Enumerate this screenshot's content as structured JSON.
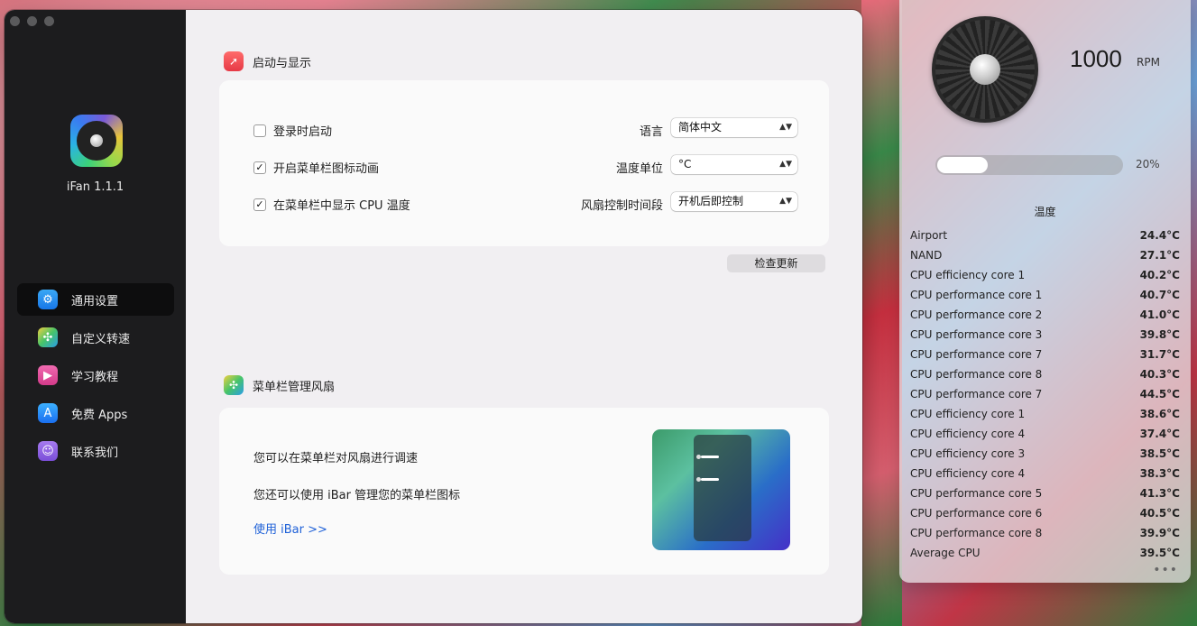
{
  "app": {
    "name": "iFan 1.1.1"
  },
  "sidebar": {
    "items": [
      {
        "label": "通用设置",
        "icon": "gear-icon"
      },
      {
        "label": "自定义转速",
        "icon": "fan-icon"
      },
      {
        "label": "学习教程",
        "icon": "video-icon"
      },
      {
        "label": "免费 Apps",
        "icon": "app-store-icon"
      },
      {
        "label": "联系我们",
        "icon": "contacts-icon"
      }
    ]
  },
  "startup": {
    "title": "启动与显示",
    "launch_at_login": {
      "label": "登录时启动",
      "checked": false
    },
    "menubar_animation": {
      "label": "开启菜单栏图标动画",
      "checked": true
    },
    "show_cpu_temp": {
      "label": "在菜单栏中显示 CPU 温度",
      "checked": true
    },
    "language": {
      "label": "语言",
      "value": "简体中文"
    },
    "temp_unit": {
      "label": "温度单位",
      "value": "°C"
    },
    "fan_control": {
      "label": "风扇控制时间段",
      "value": "开机后即控制"
    },
    "check_update": "检查更新"
  },
  "menubar": {
    "title": "菜单栏管理风扇",
    "line1": "您可以在菜单栏对风扇进行调速",
    "line2": "您还可以使用 iBar 管理您的菜单栏图标",
    "link": "使用 iBar >>"
  },
  "panel": {
    "rpm": "1000",
    "rpm_unit": "RPM",
    "percent": "20%",
    "percent_value": 0.2,
    "temp_title": "温度",
    "temps": [
      {
        "name": "Airport",
        "value": "24.4°C"
      },
      {
        "name": "NAND",
        "value": "27.1°C"
      },
      {
        "name": "CPU efficiency core 1",
        "value": "40.2°C"
      },
      {
        "name": "CPU performance core 1",
        "value": "40.7°C"
      },
      {
        "name": "CPU performance core 2",
        "value": "41.0°C"
      },
      {
        "name": "CPU performance core 3",
        "value": "39.8°C"
      },
      {
        "name": "CPU performance core 7",
        "value": "31.7°C"
      },
      {
        "name": "CPU performance core 8",
        "value": "40.3°C"
      },
      {
        "name": "CPU performance core 7",
        "value": "44.5°C"
      },
      {
        "name": "CPU efficiency core 1",
        "value": "38.6°C"
      },
      {
        "name": "CPU efficiency core 4",
        "value": "37.4°C"
      },
      {
        "name": "CPU efficiency core 3",
        "value": "38.5°C"
      },
      {
        "name": "CPU efficiency core 4",
        "value": "38.3°C"
      },
      {
        "name": "CPU performance core 5",
        "value": "41.3°C"
      },
      {
        "name": "CPU performance core 6",
        "value": "40.5°C"
      },
      {
        "name": "CPU performance core 8",
        "value": "39.9°C"
      },
      {
        "name": "Average CPU",
        "value": "39.5°C"
      }
    ]
  }
}
